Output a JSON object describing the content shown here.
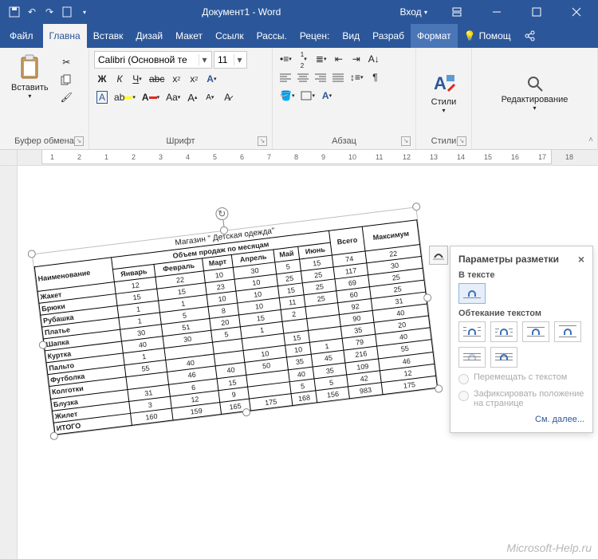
{
  "app_title": "Документ1 - Word",
  "sign_in": "Вход",
  "tabs": {
    "file": "Файл",
    "home": "Главна",
    "insert": "Вставк",
    "design": "Дизай",
    "layout": "Макет",
    "references": "Ссылк",
    "mailings": "Рассы.",
    "review": "Рецен:",
    "view": "Вид",
    "developer": "Разраб",
    "format": "Формат",
    "help": "Помощ"
  },
  "groups": {
    "clipboard": "Буфер обмена",
    "font": "Шрифт",
    "paragraph": "Абзац",
    "styles": "Стили",
    "editing": "Редактирование"
  },
  "buttons": {
    "paste": "Вставить",
    "styles": "Стили",
    "editing": "Редактирование"
  },
  "font": {
    "name": "Calibri (Основной те",
    "size": "11"
  },
  "ruler_numbers": [
    "1",
    "2",
    "1",
    "2",
    "3",
    "4",
    "5",
    "6",
    "7",
    "8",
    "9",
    "10",
    "11",
    "12",
    "13",
    "14",
    "15",
    "16",
    "17",
    "18"
  ],
  "table": {
    "title": "Магазин \" Детская одежда\"",
    "header_group": "Объем продаж по месяцам",
    "cols": [
      "Наименование",
      "Январь",
      "Февраль",
      "Март",
      "Апрель",
      "Май",
      "Июнь",
      "Всего",
      "Максимум"
    ],
    "rows": [
      {
        "name": "Жакет",
        "v": [
          "12",
          "22",
          "10",
          "30",
          "5",
          "15",
          "74",
          "22"
        ]
      },
      {
        "name": "Брюки",
        "v": [
          "15",
          "15",
          "23",
          "10",
          "25",
          "25",
          "117",
          "30"
        ]
      },
      {
        "name": "Рубашка",
        "v": [
          "1",
          "1",
          "10",
          "10",
          "15",
          "25",
          "69",
          "25"
        ]
      },
      {
        "name": "Платье",
        "v": [
          "1",
          "5",
          "8",
          "10",
          "11",
          "25",
          "60",
          "25"
        ]
      },
      {
        "name": "Шапка",
        "v": [
          "30",
          "51",
          "20",
          "15",
          "2",
          "",
          "92",
          "31"
        ]
      },
      {
        "name": "Куртка",
        "v": [
          "40",
          "30",
          "5",
          "1",
          "",
          "",
          "90",
          "40"
        ]
      },
      {
        "name": "Пальто",
        "v": [
          "1",
          "",
          "",
          "",
          "15",
          "",
          "35",
          "20"
        ]
      },
      {
        "name": "Футболка",
        "v": [
          "55",
          "40",
          "",
          "10",
          "10",
          "1",
          "79",
          "40"
        ]
      },
      {
        "name": "Колготки",
        "v": [
          "",
          "46",
          "40",
          "50",
          "35",
          "45",
          "216",
          "55"
        ]
      },
      {
        "name": "Блузка",
        "v": [
          "31",
          "6",
          "15",
          "",
          "40",
          "35",
          "109",
          "46"
        ]
      },
      {
        "name": "Жилет",
        "v": [
          "3",
          "12",
          "9",
          "",
          "5",
          "5",
          "42",
          "12"
        ]
      },
      {
        "name": "ИТОГО",
        "v": [
          "160",
          "159",
          "165",
          "175",
          "168",
          "156",
          "983",
          "175"
        ]
      }
    ]
  },
  "layout_flyout": {
    "title": "Параметры разметки",
    "sect_inline": "В тексте",
    "sect_wrap": "Обтекание текстом",
    "move_with_text": "Перемещать с текстом",
    "fix_on_page": "Зафиксировать положение на странице",
    "see_also": "См. далее..."
  },
  "watermark": "Microsoft-Help.ru",
  "chart_data": {
    "type": "table",
    "title": "Магазин \"Детская одежда\" — Объем продаж по месяцам",
    "columns": [
      "Наименование",
      "Январь",
      "Февраль",
      "Март",
      "Апрель",
      "Май",
      "Июнь",
      "Всего",
      "Максимум"
    ],
    "rows": [
      [
        "Жакет",
        12,
        22,
        10,
        30,
        5,
        15,
        74,
        22
      ],
      [
        "Брюки",
        15,
        15,
        23,
        10,
        25,
        25,
        117,
        30
      ],
      [
        "Рубашка",
        1,
        1,
        10,
        10,
        15,
        25,
        69,
        25
      ],
      [
        "Платье",
        1,
        5,
        8,
        10,
        11,
        25,
        60,
        25
      ],
      [
        "Шапка",
        30,
        51,
        20,
        15,
        2,
        null,
        92,
        31
      ],
      [
        "Куртка",
        40,
        30,
        5,
        1,
        null,
        null,
        90,
        40
      ],
      [
        "Пальто",
        1,
        null,
        null,
        null,
        15,
        null,
        35,
        20
      ],
      [
        "Футболка",
        55,
        40,
        null,
        10,
        10,
        1,
        79,
        40
      ],
      [
        "Колготки",
        null,
        46,
        40,
        50,
        35,
        45,
        216,
        55
      ],
      [
        "Блузка",
        31,
        6,
        15,
        null,
        40,
        35,
        109,
        46
      ],
      [
        "Жилет",
        3,
        12,
        9,
        null,
        5,
        5,
        42,
        12
      ],
      [
        "ИТОГО",
        160,
        159,
        165,
        175,
        168,
        156,
        983,
        175
      ]
    ]
  }
}
